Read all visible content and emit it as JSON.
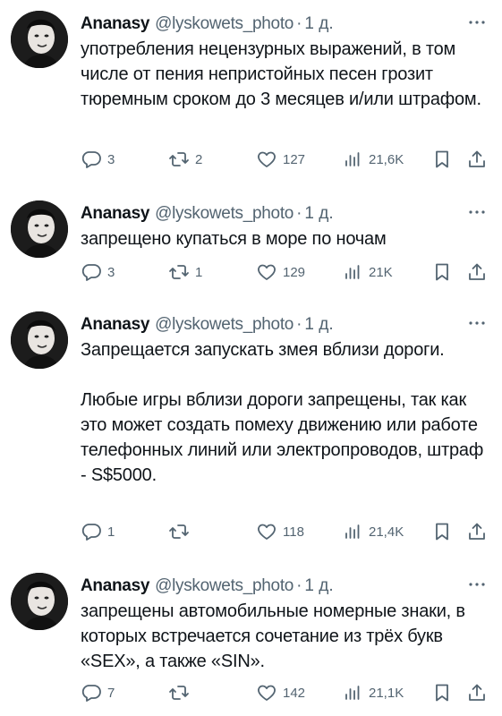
{
  "tweets": [
    {
      "name": "Ananasy",
      "handle": "@lyskowets_photo",
      "sep": "·",
      "time": "1 д.",
      "paragraphs": [
        "употребления нецензурных выражений, в том числе от пения непристойных песен грозит тюремным сроком до 3 месяцев и/или штрафом."
      ],
      "replies": "3",
      "retweets": "2",
      "likes": "127",
      "views": "21,6K"
    },
    {
      "name": "Ananasy",
      "handle": "@lyskowets_photo",
      "sep": "·",
      "time": "1 д.",
      "paragraphs": [
        "запрещено купаться в море по ночам"
      ],
      "replies": "3",
      "retweets": "1",
      "likes": "129",
      "views": "21K"
    },
    {
      "name": "Ananasy",
      "handle": "@lyskowets_photo",
      "sep": "·",
      "time": "1 д.",
      "paragraphs": [
        "Запрещается запускать змея вблизи дороги.",
        "Любые игры вблизи дороги запрещены, так как это может создать помеху движению или работе телефонных линий или электропроводов, штраф - S$5000."
      ],
      "replies": "1",
      "retweets": "",
      "likes": "118",
      "views": "21,4K"
    },
    {
      "name": "Ananasy",
      "handle": "@lyskowets_photo",
      "sep": "·",
      "time": "1 д.",
      "paragraphs": [
        "запрещены автомобильные номерные знаки, в которых встречается сочетание из трёх букв «SEX», а также «SIN»."
      ],
      "replies": "7",
      "retweets": "",
      "likes": "142",
      "views": "21,1K"
    }
  ]
}
